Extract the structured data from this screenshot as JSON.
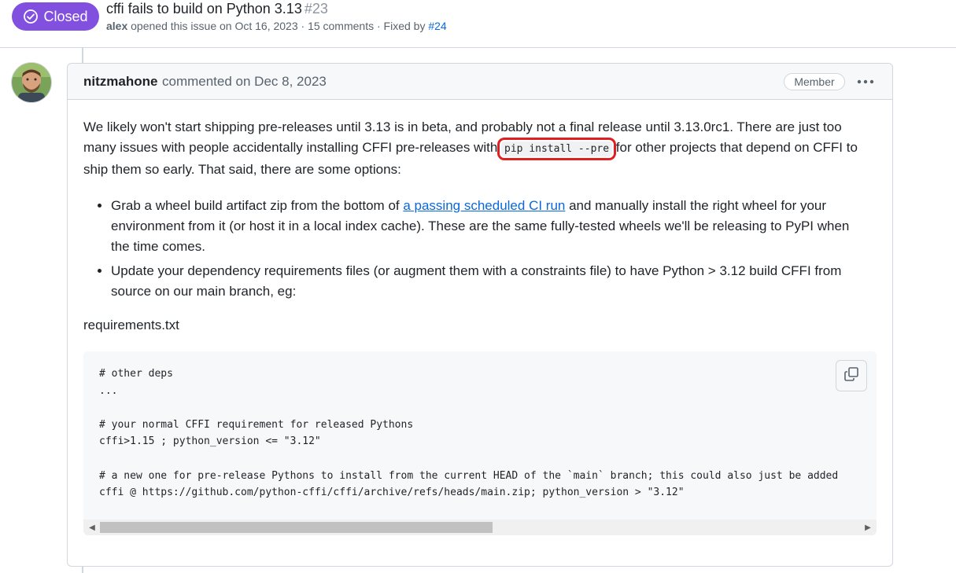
{
  "issue": {
    "state": "Closed",
    "title": "cffi fails to build on Python 3.13",
    "number": "#23",
    "opener": "alex",
    "opened_text": "opened this issue on Oct 16, 2023 · 15 comments · Fixed by",
    "fixed_by": "#24"
  },
  "comment": {
    "author": "nitzmahone",
    "action": "commented on Dec 8, 2023",
    "role_badge": "Member",
    "more_label": "•••",
    "para1_a": "We likely won't start shipping pre-releases until 3.13 is in beta, and probably not a final release until 3.13.0rc1. There are just too many issues with people accidentally installing CFFI pre-releases with ",
    "para1_code": "pip install --pre",
    "para1_b": " for other projects that depend on CFFI to ship them so early. That said, there are some options:",
    "bullet1_a": "Grab a wheel build artifact zip from the bottom of ",
    "bullet1_link": "a passing scheduled CI run",
    "bullet1_b": " and manually install the right wheel for your environment from it (or host it in a local index cache). These are the same fully-tested wheels we'll be releasing to PyPI when the time comes.",
    "bullet2": "Update your dependency requirements files (or augment them with a constraints file) to have Python > 3.12 build CFFI from source on our main branch, eg:",
    "filename": "requirements.txt",
    "code": "# other deps\n...\n\n# your normal CFFI requirement for released Pythons\ncffi>1.15 ; python_version <= \"3.12\"\n\n# a new one for pre-release Pythons to install from the current HEAD of the `main` branch; this could also just be added\ncffi @ https://github.com/python-cffi/cffi/archive/refs/heads/main.zip; python_version > \"3.12\""
  },
  "icons": {
    "state": "check-circle-icon",
    "copy": "copy-icon",
    "more": "kebab-horizontal-icon"
  },
  "colors": {
    "closed_badge": "#8250df",
    "link": "#0969da",
    "highlight_box": "#e02020"
  }
}
